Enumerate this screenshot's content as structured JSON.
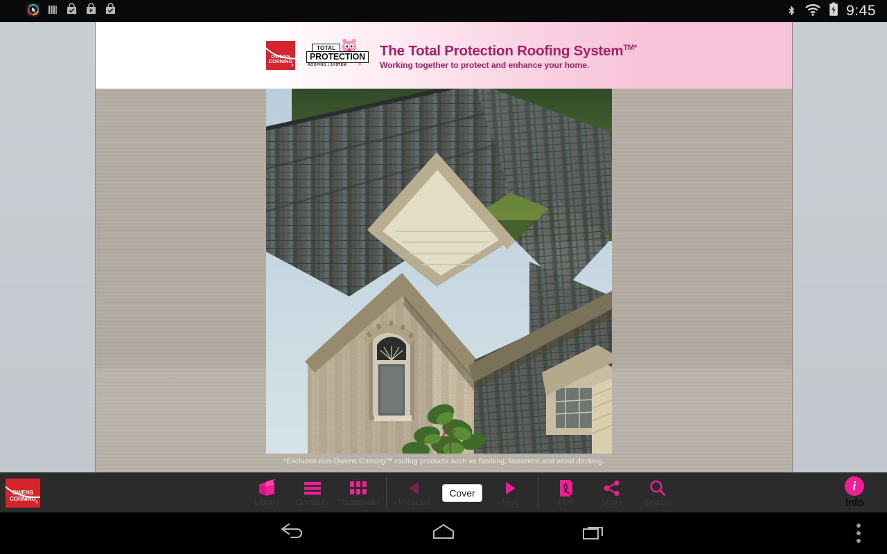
{
  "statusbar": {
    "clock": "9:45",
    "left_icons": [
      {
        "name": "app-launcher-icon"
      },
      {
        "name": "bars-icon"
      },
      {
        "name": "bag-check-icon-1"
      },
      {
        "name": "bag-play-icon"
      },
      {
        "name": "bag-check-icon-2"
      }
    ],
    "right_icons": [
      {
        "name": "bluetooth-icon"
      },
      {
        "name": "wifi-icon"
      },
      {
        "name": "battery-charging-icon"
      }
    ]
  },
  "document": {
    "header": {
      "brand_logo_line1": "OWENS",
      "brand_logo_line2": "CORNING",
      "brand_registered": "®",
      "badge_total": "TOTAL",
      "badge_protection": "PROTECTION",
      "badge_subtitle": "ROOFING | SYSTEM",
      "title": "The Total Protection Roofing System",
      "title_sup": "TM*",
      "subtitle": "Working together to protect and enhance your home."
    },
    "footnote": "*Excludes non-Owens Corning™ roofing products such as flashing, fasteners and wood decking.",
    "photo_alt": "House roof with multi-colored architectural shingles, brick gable and arched window"
  },
  "toolbar": {
    "brand_logo_line1": "OWENS",
    "brand_logo_line2": "CORNING",
    "brand_registered": "®",
    "items": [
      {
        "name": "library",
        "label": "Library",
        "icon": "books-icon"
      },
      {
        "name": "contents",
        "label": "Contents",
        "icon": "list-icon"
      },
      {
        "name": "thumbnails",
        "label": "Thumbnails",
        "icon": "grid-icon"
      },
      {
        "name": "previous",
        "label": "Previous",
        "icon": "triangle-left-icon"
      },
      {
        "name": "next",
        "label": "Next",
        "icon": "triangle-right-icon"
      },
      {
        "name": "pdf",
        "label": "PDF",
        "icon": "pdf-icon"
      },
      {
        "name": "share",
        "label": "Share",
        "icon": "share-icon"
      },
      {
        "name": "search",
        "label": "Search",
        "icon": "magnifier-icon"
      }
    ],
    "page_field_value": "Cover",
    "page_field_placeholder": "Page",
    "info_label": "Info",
    "info_glyph": "i"
  },
  "navbar": {
    "back_label": "Back",
    "home_label": "Home",
    "recent_label": "Recent apps",
    "more_label": "More options"
  },
  "colors": {
    "accent_pink": "#f01f95",
    "brand_red": "#d6242c",
    "header_pink": "#f7c3d8",
    "header_text": "#a81f66",
    "toolbar_bg": "#2b2b2b",
    "page_bg": "#b3aca3",
    "viewer_bg": "#c5cace"
  }
}
